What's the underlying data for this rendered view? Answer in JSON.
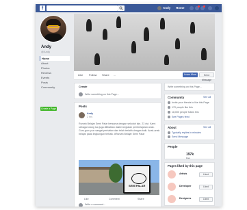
{
  "topbar": {
    "logo": "f",
    "search_placeholder": "",
    "user_short": "Andy",
    "home_label": "Home",
    "icons": [
      "friends-icon",
      "messages-icon",
      "notifications-icon",
      "help-icon",
      "dropdown-icon"
    ]
  },
  "profile": {
    "name": "Andy",
    "handle": "@Andy",
    "nav": [
      "Home",
      "About",
      "Photos",
      "Reviews",
      "Events",
      "Posts",
      "Community"
    ],
    "create_page": "Create a Page"
  },
  "actions": {
    "like": "Like",
    "follow": "Follow",
    "share": "Share",
    "more": "...",
    "learn_more": "Learn More",
    "send_message": "Send Message"
  },
  "composer": {
    "title": "Create",
    "placeholder": "Write something on this Page..."
  },
  "posts_header": "Posts",
  "post": {
    "author": "Andy",
    "time": "2 hrs",
    "text1": "Rumah Belajar Semi Palar bersama dengan sekolah lain. 23 dst. Kami",
    "text2": "sebagai orang tua juga dilibatkan dalam kegiatan pembelajaran anak.",
    "text3": "Guru-guru pun sangat perhatian dan telah terlatih dengan baik. Anak-anak",
    "text4": "belajar pada lingkungan terbaik. #Rumah Belajar Semi Palar",
    "gate_text": "SEMI PALAR",
    "like": "Like",
    "comment": "Comment",
    "share": "Share",
    "comment_placeholder": "Write a comment..."
  },
  "sidebar": {
    "community_header": "Community",
    "community_link": "See All",
    "community_items": [
      "Invite your friends to like this Page",
      "170 people like this",
      "18,000 people follow this",
      "See Pages feed"
    ],
    "about_header": "About",
    "about_link": "See All",
    "about_items": [
      "Typically replies in minutes",
      "Send Message"
    ],
    "people_header": "People",
    "people_count": "197k",
    "people_label": "likes",
    "pages_header": "Pages liked by this page",
    "pages": [
      {
        "name": "Artists",
        "like": "Liked"
      },
      {
        "name": "Developer",
        "like": "Liked"
      },
      {
        "name": "Designers",
        "like": "Liked"
      }
    ]
  }
}
